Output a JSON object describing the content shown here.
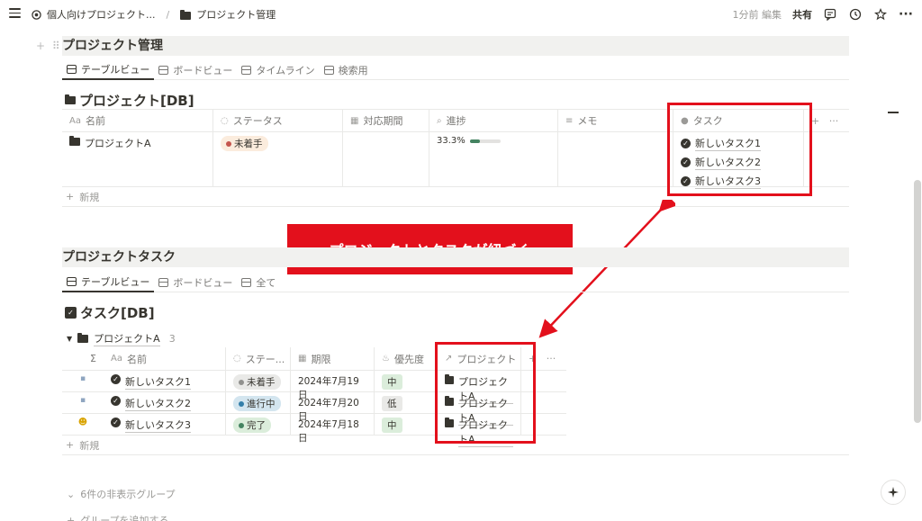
{
  "topbar": {
    "breadcrumb_root": "個人向けプロジェクト...",
    "breadcrumb_sep": "/",
    "breadcrumb_current": "プロジェクト管理",
    "edited": "1分前 編集",
    "share": "共有"
  },
  "section1": {
    "title": "プロジェクト管理",
    "tabs": [
      "テーブルビュー",
      "ボードビュー",
      "タイムライン",
      "検索用"
    ],
    "db_title": "プロジェクト[DB]",
    "columns": {
      "name": "名前",
      "name_prefix": "Aa",
      "status": "ステータス",
      "period": "対応期間",
      "progress": "進捗",
      "memo": "メモ",
      "task": "タスク"
    },
    "row": {
      "name": "プロジェクトA",
      "status": "未着手",
      "progress_label": "33.3%",
      "progress": 0.333,
      "tasks": [
        "新しいタスク1",
        "新しいタスク2",
        "新しいタスク3"
      ]
    },
    "new_label": "新規"
  },
  "callout": "プロジェクトとタスクが紐づく",
  "section2": {
    "title": "プロジェクトタスク",
    "tabs": [
      "テーブルビュー",
      "ボードビュー",
      "全て"
    ],
    "db_title": "タスク[DB]",
    "group_name": "プロジェクトA",
    "group_count": "3",
    "columns": {
      "sigma": "Σ",
      "name": "名前",
      "name_prefix": "Aa",
      "status": "ステー...",
      "date": "期限",
      "priority": "優先度",
      "project": "プロジェクト"
    },
    "rows": [
      {
        "name": "新しいタスク1",
        "status": "未着手",
        "date": "2024年7月19日",
        "priority": "中",
        "project": "プロジェクトA"
      },
      {
        "name": "新しいタスク2",
        "status": "進行中",
        "date": "2024年7月20日",
        "priority": "低",
        "project": "プロジェクトA"
      },
      {
        "name": "新しいタスク3",
        "status": "完了",
        "date": "2024年7月18日",
        "priority": "中",
        "project": "プロジェクトA"
      }
    ],
    "new_label": "新規",
    "hidden_groups": "6件の非表示グループ",
    "add_group": "グループを追加する"
  },
  "colors": {
    "accent_red": "#e3101c",
    "status_not_started_bg": "#fbecdd",
    "status_in_progress_bg": "#d3e5ef",
    "status_done_bg": "#dbeddb",
    "priority_mid_bg": "#dbeddb",
    "priority_low_bg": "#e9e9e7"
  }
}
